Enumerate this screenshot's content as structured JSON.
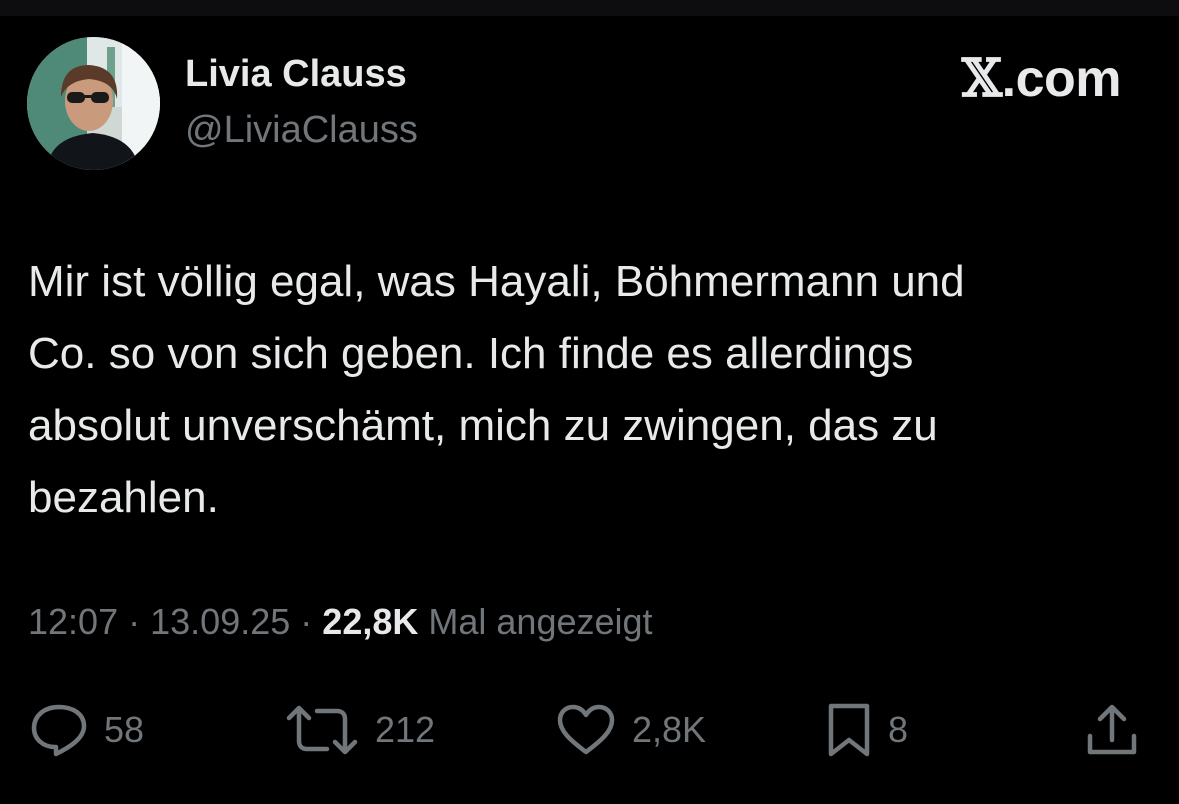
{
  "author": {
    "name": "Livia Clauss",
    "handle": "@LiviaClauss"
  },
  "brand": {
    "x_glyph": "𝕏",
    "domain": ".com"
  },
  "tweet": {
    "text": "Mir ist völlig egal, was Hayali, Böhmermann und\nCo. so von sich geben.  Ich finde es allerdings\nabsolut unverschämt, mich zu zwingen, das zu\nbezahlen.",
    "time": "12:07",
    "separator": "·",
    "date": "13.09.25",
    "views_count": "22,8K",
    "views_label": "Mal angezeigt"
  },
  "actions": {
    "replies": "58",
    "reposts": "212",
    "likes": "2,8K",
    "bookmarks": "8"
  },
  "icons": {
    "reply": "reply-icon",
    "repost": "repost-icon",
    "like": "heart-icon",
    "bookmark": "bookmark-icon",
    "share": "share-icon"
  },
  "colors": {
    "background": "#000000",
    "text_primary": "#e7e9ea",
    "text_secondary": "#71767b"
  }
}
